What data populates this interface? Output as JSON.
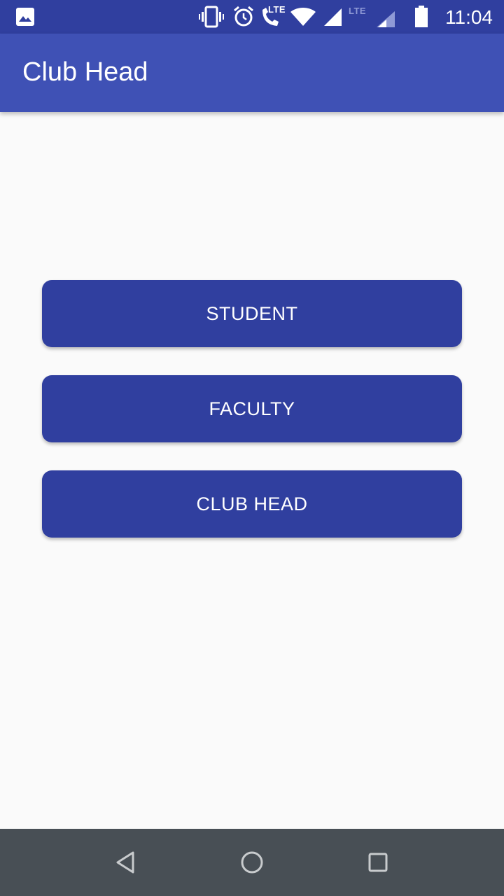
{
  "status_bar": {
    "time": "11:04",
    "lte_call": "LTE",
    "lte_signal": "LTE",
    "icons": [
      "gallery-icon",
      "vibrate-icon",
      "alarm-icon",
      "call-icon",
      "wifi-icon",
      "signal-icon",
      "signal-icon",
      "battery-icon"
    ]
  },
  "app_bar": {
    "title": "Club Head"
  },
  "buttons": {
    "student": "STUDENT",
    "faculty": "FACULTY",
    "club_head": "CLUB HEAD"
  },
  "colors": {
    "status_bar": "#303f9f",
    "app_bar": "#3f51b5",
    "button": "#303f9f",
    "background": "#fafafa",
    "nav_bar": "#484f55"
  },
  "nav_bar": {
    "icons": [
      "back-icon",
      "home-icon",
      "recent-apps-icon"
    ]
  }
}
